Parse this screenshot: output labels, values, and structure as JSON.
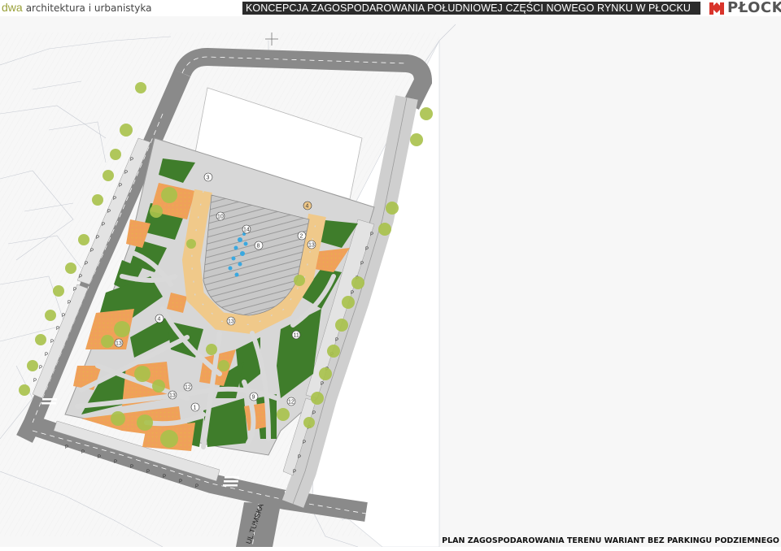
{
  "header": {
    "brand_short": "dwa",
    "brand_rest": "architektura i urbanistyka",
    "title": "KONCEPCJA ZAGOSPODAROWANIA POŁUDNIOWEJ CZĘŚCI NOWEGO RYNKU W PŁOCKU",
    "logo_text": "PŁOCK"
  },
  "map": {
    "street_label": "UL.TUMSKA",
    "zone_numbers": [
      "3",
      "10",
      "14",
      "8",
      "2",
      "13",
      "4",
      "13",
      "11",
      "13",
      "12",
      "13",
      "9",
      "12",
      "1",
      "4"
    ],
    "parking_marker": "P"
  },
  "caption": "PLAN ZAGOSPODAROWANIA TERENU WARIANT BEZ PARKINGU PODZIEMNEGO",
  "colors": {
    "brand_accent": "#9aa13a",
    "title_bar": "#2b2b2b",
    "logo_red": "#d9342b",
    "road": "#8a8a8a",
    "paving": "#d7d7d7",
    "grass": "#3f7d2b",
    "orange": "#f0a05a",
    "tree": "#a9c24b"
  }
}
